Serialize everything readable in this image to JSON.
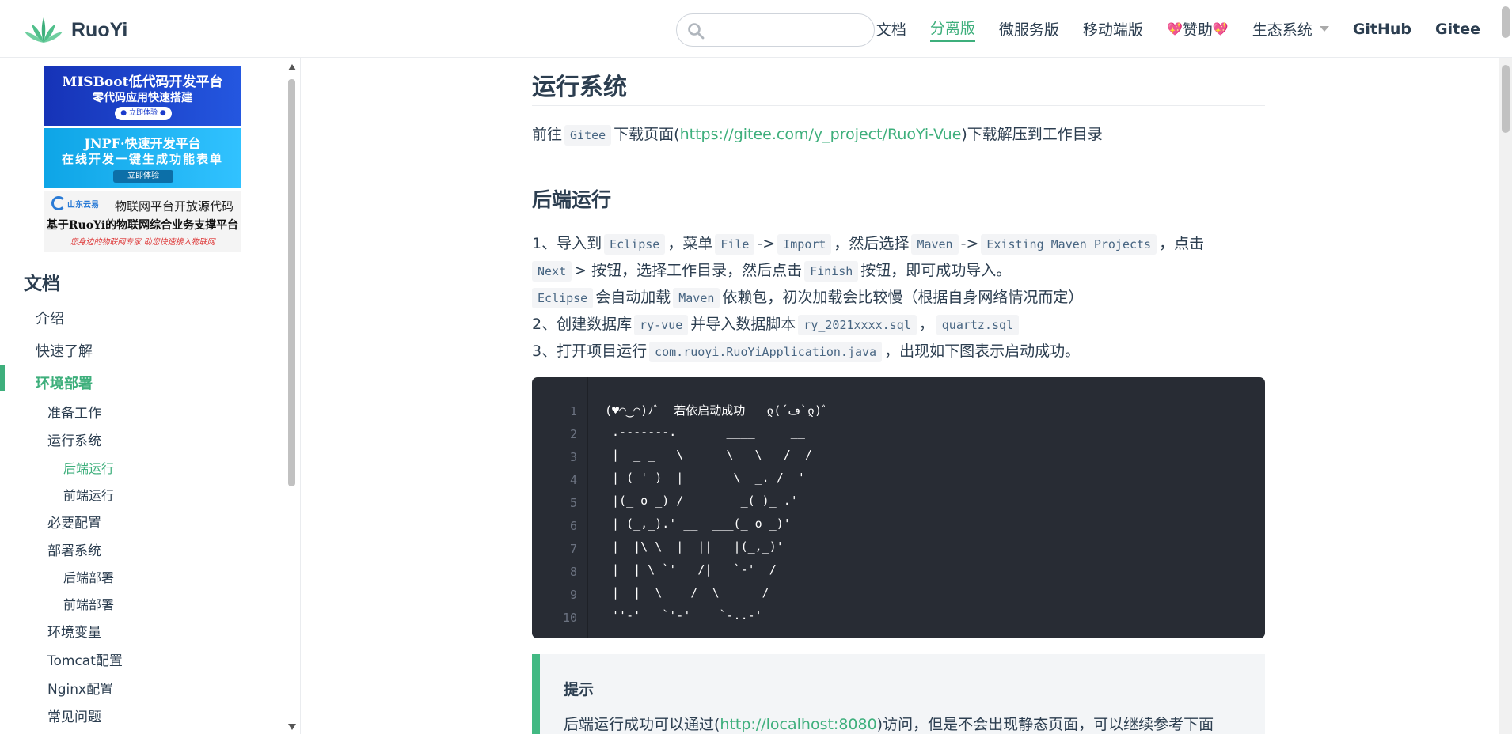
{
  "navbar": {
    "brand": "RuoYi",
    "search_placeholder": "",
    "links": [
      {
        "label": "文档"
      },
      {
        "label": "分离版"
      },
      {
        "label": "微服务版"
      },
      {
        "label": "移动端版"
      },
      {
        "label": "赞助",
        "heart": "💖"
      },
      {
        "label": "生态系统"
      },
      {
        "label": "GitHub"
      },
      {
        "label": "Gitee"
      }
    ]
  },
  "sidebar": {
    "ads": {
      "ad1": {
        "title": "MISBoot低代码开发平台",
        "subtitle": "零代码应用快速搭建",
        "button": "● 立即体验 ●"
      },
      "ad2": {
        "title": "JNPF·快速开发平台",
        "subtitle": "在线开发一键生成功能表单",
        "button": "立即体验"
      },
      "ad3": {
        "brand": "山东云易",
        "title": "物联网平台开放源代码",
        "subtitle": "基于RuoYi的物联网综合业务支撑平台",
        "tagline": "您身边的物联网专家  助您快速接入物联网"
      }
    },
    "heading": "文档",
    "items": [
      {
        "label": "介绍"
      },
      {
        "label": "快速了解"
      },
      {
        "label": "环境部署"
      },
      {
        "label": "准备工作"
      },
      {
        "label": "运行系统"
      },
      {
        "label": "后端运行"
      },
      {
        "label": "前端运行"
      },
      {
        "label": "必要配置"
      },
      {
        "label": "部署系统"
      },
      {
        "label": "后端部署"
      },
      {
        "label": "前端部署"
      },
      {
        "label": "环境变量"
      },
      {
        "label": "Tomcat配置"
      },
      {
        "label": "Nginx配置"
      },
      {
        "label": "常见问题"
      }
    ]
  },
  "content": {
    "title": "运行系统",
    "intro": {
      "pre": "前往",
      "code": "Gitee",
      "mid": "下载页面(",
      "link": "https://gitee.com/y_project/RuoYi-Vue",
      "post": ")下载解压到工作目录"
    },
    "section_title": "后端运行",
    "step1": {
      "a": "1、导入到",
      "c1": "Eclipse",
      "b": "，菜单",
      "c2": "File",
      "arrow1": "->",
      "c3": "Import",
      "d": "，然后选择",
      "c4": "Maven",
      "arrow2": "->",
      "c5": "Existing Maven Projects",
      "e": "，点击"
    },
    "step1b": {
      "c1": "Next",
      "a": "> 按钮，选择工作目录，然后点击",
      "c2": "Finish",
      "b": "按钮，即可成功导入。"
    },
    "step1c": {
      "c1": "Eclipse",
      "a": "会自动加载",
      "c2": "Maven",
      "b": "依赖包，初次加载会比较慢（根据自身网络情况而定）"
    },
    "step2": {
      "a": "2、创建数据库",
      "c1": "ry-vue",
      "b": "并导入数据脚本",
      "c2": "ry_2021xxxx.sql",
      "c": "，",
      "c3": "quartz.sql"
    },
    "step3": {
      "a": "3、打开项目运行",
      "c1": "com.ruoyi.RuoYiApplication.java",
      "b": "，出现如下图表示启动成功。"
    },
    "code_lines": [
      "(♥◠‿◠)ﾉﾞ  若依启动成功   ლ(´ڡ`ლ)ﾞ",
      " .-------.       ____     __",
      " |  _ _   \\      \\   \\   /  /",
      " | ( ' )  |       \\  _. /  '",
      " |(_ o _) /        _( )_ .'",
      " | (_,_).' __  ___(_ o _)'",
      " |  |\\ \\  |  ||   |(_,_)'",
      " |  | \\ `'   /|   `-'  /",
      " |  |  \\    /  \\      /",
      " ''-'   `'-'    `-..-'"
    ],
    "line_numbers": [
      "1",
      "2",
      "3",
      "4",
      "5",
      "6",
      "7",
      "8",
      "9",
      "10"
    ],
    "tip": {
      "title": "提示",
      "pre": "后端运行成功可以通过(",
      "link": "http://localhost:8080",
      "post": ")访问，但是不会出现静态页面，可以继续参考下面"
    }
  },
  "colors": {
    "accent": "#3eaf7c",
    "code_bg": "#282c34",
    "text": "#2c3e50"
  }
}
